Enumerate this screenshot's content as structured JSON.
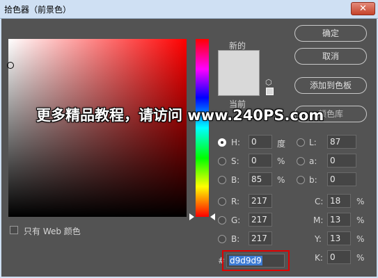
{
  "window": {
    "title": "拾色器（前景色）",
    "close_icon": "✕"
  },
  "labels": {
    "new": "新的",
    "current": "当前",
    "only_web": "只有 Web 颜色",
    "hex_prefix": "#"
  },
  "buttons": {
    "ok": "确定",
    "cancel": "取消",
    "add_swatch": "添加到色板",
    "libraries": "颜色库"
  },
  "watermark": "更多精品教程，请访问 www.240PS.com",
  "color": {
    "hex_display": "d9d9d9",
    "swatch": "#d9d9d9",
    "selected_hue": "#ff0000"
  },
  "hsb": {
    "h": {
      "label": "H:",
      "value": "0",
      "unit": "度"
    },
    "s": {
      "label": "S:",
      "value": "0",
      "unit": "%"
    },
    "b": {
      "label": "B:",
      "value": "85",
      "unit": "%"
    }
  },
  "rgb": {
    "r": {
      "label": "R:",
      "value": "217"
    },
    "g": {
      "label": "G:",
      "value": "217"
    },
    "b": {
      "label": "B:",
      "value": "217"
    }
  },
  "lab": {
    "l": {
      "label": "L:",
      "value": "87"
    },
    "a": {
      "label": "a:",
      "value": "0"
    },
    "b": {
      "label": "b:",
      "value": "0"
    }
  },
  "cmyk": {
    "c": {
      "label": "C:",
      "value": "18",
      "unit": "%"
    },
    "m": {
      "label": "M:",
      "value": "13",
      "unit": "%"
    },
    "y": {
      "label": "Y:",
      "value": "13",
      "unit": "%"
    },
    "k": {
      "label": "K:",
      "value": "0",
      "unit": "%"
    }
  }
}
